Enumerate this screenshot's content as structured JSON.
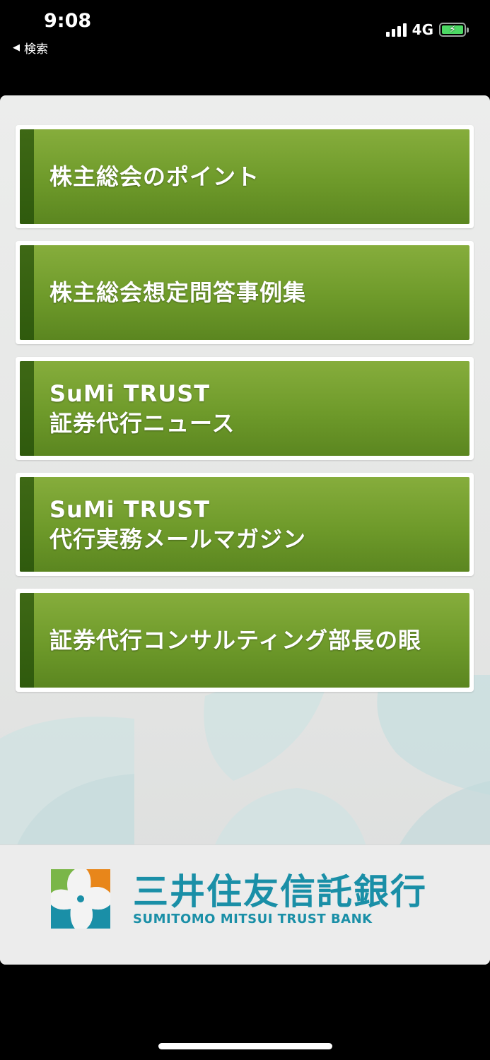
{
  "status_bar": {
    "time": "9:08",
    "back_label": "検索",
    "network": "4G"
  },
  "menu": {
    "items": [
      {
        "lines": [
          "株主総会のポイント"
        ]
      },
      {
        "lines": [
          "株主総会想定問答事例集"
        ]
      },
      {
        "lines": [
          "SuMi TRUST",
          "証券代行ニュース"
        ]
      },
      {
        "lines": [
          "SuMi TRUST",
          "代行実務メールマガジン"
        ]
      },
      {
        "lines": [
          "証券代行コンサルティング部長の眼"
        ]
      }
    ]
  },
  "footer": {
    "logo_jp": "三井住友信託銀行",
    "logo_en": "SUMITOMO MITSUI TRUST BANK"
  },
  "colors": {
    "button_green": "#6e9a2a",
    "button_stripe": "#2f5a0d",
    "brand_teal": "#1a8fa7",
    "brand_orange": "#e8861a",
    "brand_green": "#7ab648"
  }
}
